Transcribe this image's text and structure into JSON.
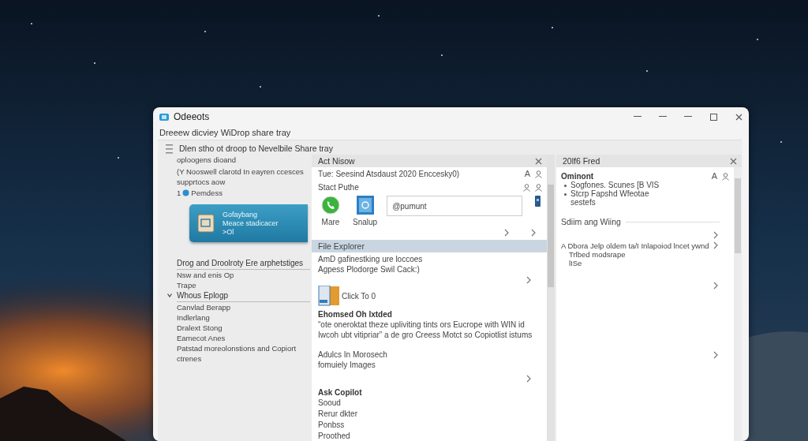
{
  "window": {
    "title": "Odeeots",
    "subtitle": "Dreeew dicviey WiDrop share tray"
  },
  "left_panel": {
    "heading": "Dlen stho ot droop to Nevelbile Share  tray",
    "items": [
      {
        "kind": "text",
        "text": "oploogens dioand"
      },
      {
        "kind": "text",
        "text": "(Y Nooswell clarotd In eayren ccesces"
      },
      {
        "kind": "text",
        "text": "supprtocs aow"
      },
      {
        "kind": "badge",
        "number": "1",
        "text": "Pemdess"
      },
      {
        "kind": "card",
        "lines": [
          "Gofaybang",
          "Meace stadicacer",
          ">Ol"
        ]
      },
      {
        "kind": "section",
        "text": "Drog and Droolroty Ere arphetstiges"
      },
      {
        "kind": "text",
        "text": "Nsw and enis Op"
      },
      {
        "kind": "text",
        "text": "Trape"
      },
      {
        "kind": "section",
        "text": "Whous Eplogp",
        "expanded": true
      },
      {
        "kind": "text",
        "text": "Canvlad Berapp"
      },
      {
        "kind": "text",
        "text": "Indlerlang"
      },
      {
        "kind": "text",
        "text": "Dralext Stong"
      },
      {
        "kind": "text",
        "text": "Eamecot Anes"
      },
      {
        "kind": "text",
        "text": "Patstad moreolonstions and Copiort"
      },
      {
        "kind": "text",
        "text": "ctrenes"
      }
    ]
  },
  "middle_panel": {
    "title": "Act Nisow",
    "date_line": "Tue: Seesind Atsdaust 2020 Enccesky0)",
    "date_letter": "A",
    "subheading": "Stact Puthe",
    "apps": [
      {
        "kind": "phone",
        "label": "Mare"
      },
      {
        "kind": "at",
        "label": "Snalup"
      }
    ],
    "share_field": {
      "value": "@pumunt"
    },
    "section": "File Explorer",
    "section_lines": [
      "AmD gafinestking ure loccoes",
      "Agpess Plodorge Swil Cack:)"
    ],
    "file": {
      "label": "Click To 0"
    },
    "note_title": "Ehomsed Oh lxtded",
    "note_lines": [
      "“ote oneroktat theze upliviting tints ors Eucrope with WIN id",
      "Iwcoh ubt vitipriar” a de gro Creess Motct so Copiotlist istums"
    ],
    "extra_lines": [
      "Adulcs In Morosech",
      "fomuiely Images"
    ],
    "ask_title": "Ask Copilot",
    "ask_items": [
      "Sooud",
      "Rerur dkter",
      "Ponbss",
      "Proothed"
    ]
  },
  "right_panel": {
    "title": "20lf6 Fred",
    "heading": "Ominont",
    "heading_letter": "A",
    "bullets": [
      {
        "lines": [
          "Sogfones. Scunes [B VIS"
        ]
      },
      {
        "lines": [
          "Stcrp Fapshd Wfeotae",
          "sestefs"
        ]
      }
    ],
    "section": "Sdiim ang Wiing",
    "entry_lines": [
      "A Dbora Jelp oldem ta/I Inlapoiod lncet ywnd",
      "Trlbed modsrape",
      "lISe"
    ]
  }
}
